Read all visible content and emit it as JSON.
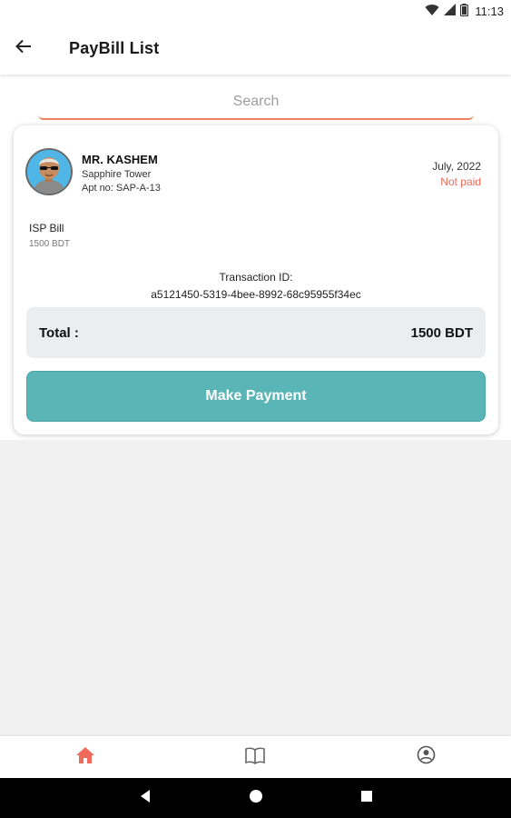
{
  "status_bar": {
    "time": "11:13",
    "icons": [
      "wifi-icon",
      "signal-icon",
      "battery-icon"
    ]
  },
  "app_bar": {
    "back_icon": "arrow-left-icon",
    "title": "PayBill List"
  },
  "search": {
    "placeholder": "Search",
    "value": ""
  },
  "bill_card": {
    "resident": {
      "name": "MR. KASHEM",
      "building": "Sapphire Tower",
      "apartment": "Apt no: SAP-A-13"
    },
    "date": "July, 2022",
    "status": "Not paid",
    "bill_type": "ISP Bill",
    "bill_amount": "1500 BDT",
    "transaction_label": "Transaction ID:",
    "transaction_id": "a5121450-5319-4bee-8992-68c95955f34ec",
    "total_label": "Total :",
    "total_value": "1500 BDT",
    "pay_button": "Make Payment"
  },
  "bottom_nav": {
    "items": [
      {
        "icon": "home-icon",
        "active": true
      },
      {
        "icon": "book-icon",
        "active": false
      },
      {
        "icon": "profile-icon",
        "active": false
      }
    ]
  },
  "colors": {
    "accent": "#ef6a5a",
    "teal": "#5ab5b6",
    "active_nav": "#ef6a5a"
  }
}
